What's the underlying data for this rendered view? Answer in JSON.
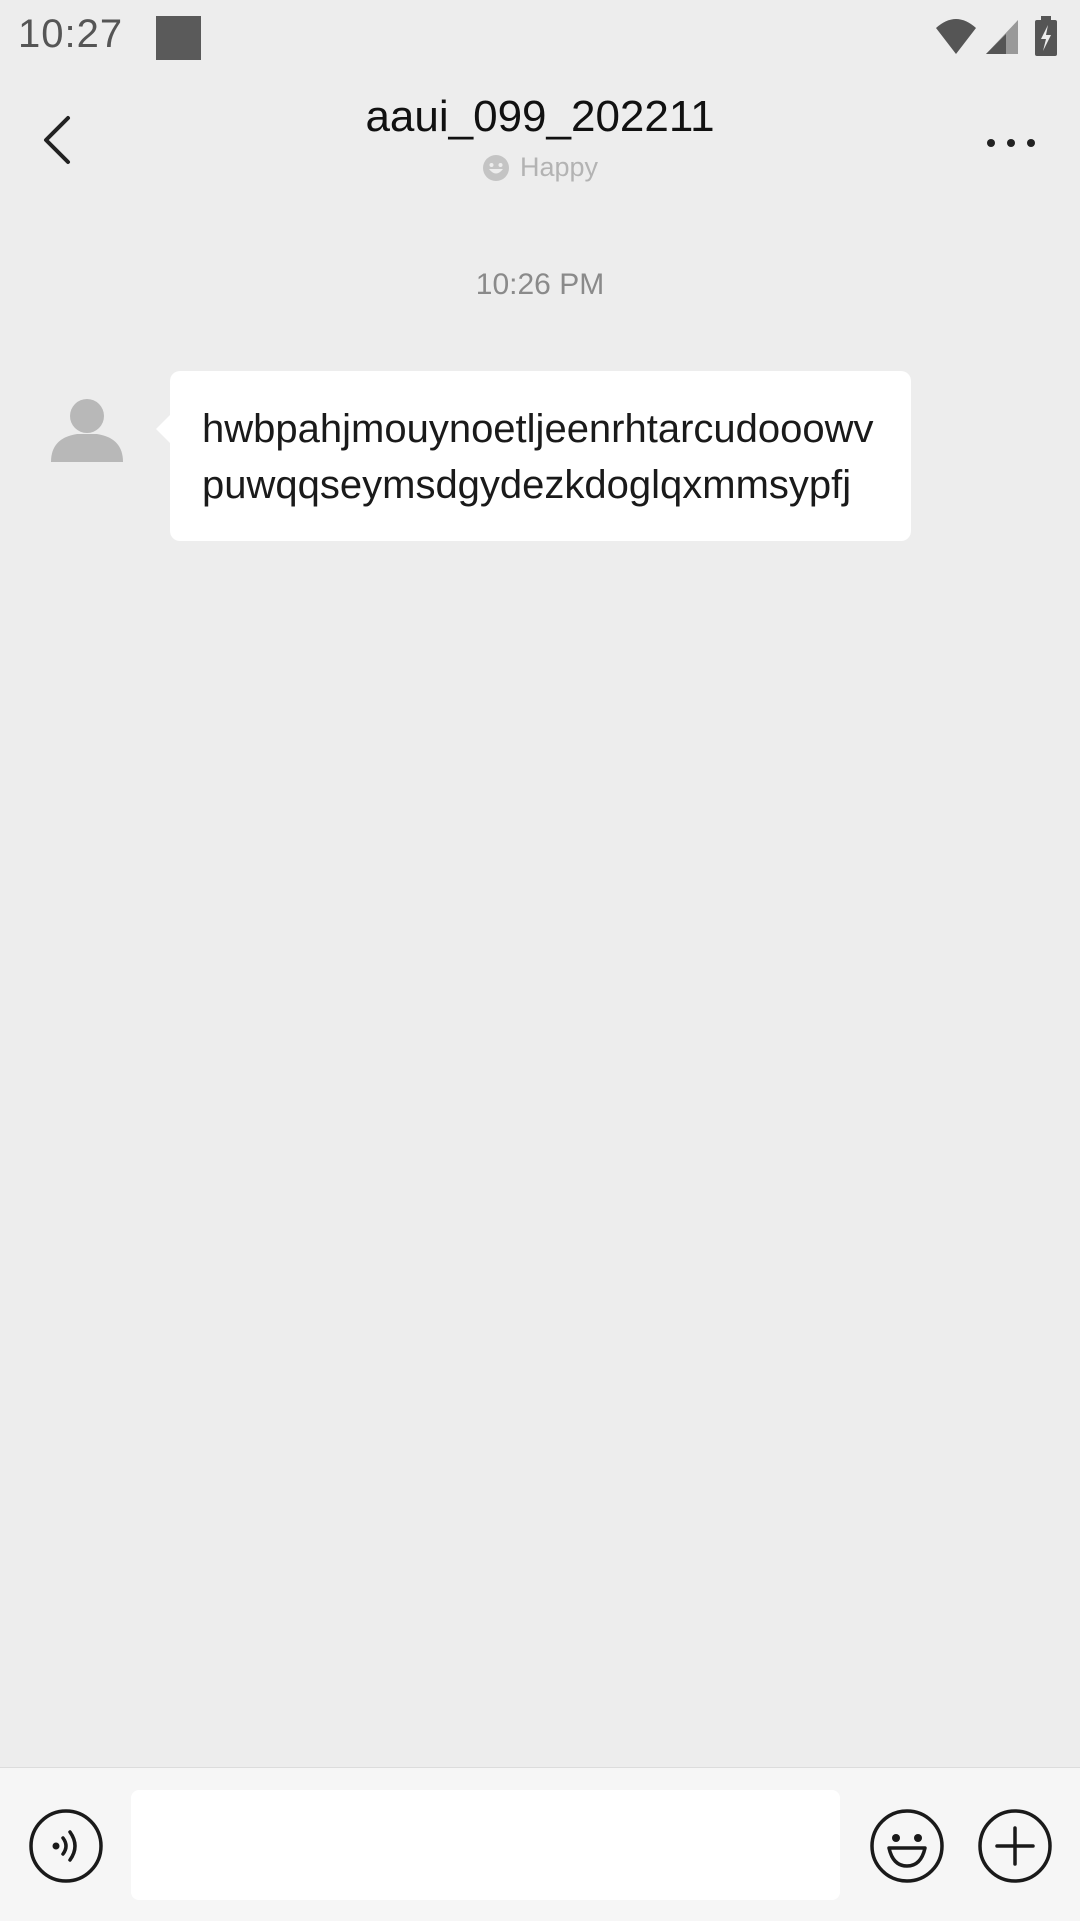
{
  "status_bar": {
    "time": "10:27",
    "icons": [
      "notification-square-icon",
      "wifi-icon",
      "cell-signal-icon",
      "battery-charging-icon"
    ]
  },
  "header": {
    "title": "aaui_099_202211",
    "mood": "Happy",
    "icons": [
      "back-arrow-icon",
      "mood-smiley-icon",
      "more-dots-icon"
    ]
  },
  "chat": {
    "timestamp": "10:26 PM",
    "messages": [
      {
        "sender": "contact",
        "text": "hwbpahjmouynoetljeenrhtarcudooowvpuwqqseymsdgydezkdoglqxmmsypfj"
      }
    ]
  },
  "input_bar": {
    "value": "",
    "placeholder": "",
    "icons": [
      "voice-icon",
      "emoji-icon",
      "plus-icon"
    ]
  },
  "colors": {
    "background": "#ededed",
    "bubble": "#ffffff",
    "bottom_bar": "#f6f6f6",
    "muted_text": "#8a8a8a"
  }
}
